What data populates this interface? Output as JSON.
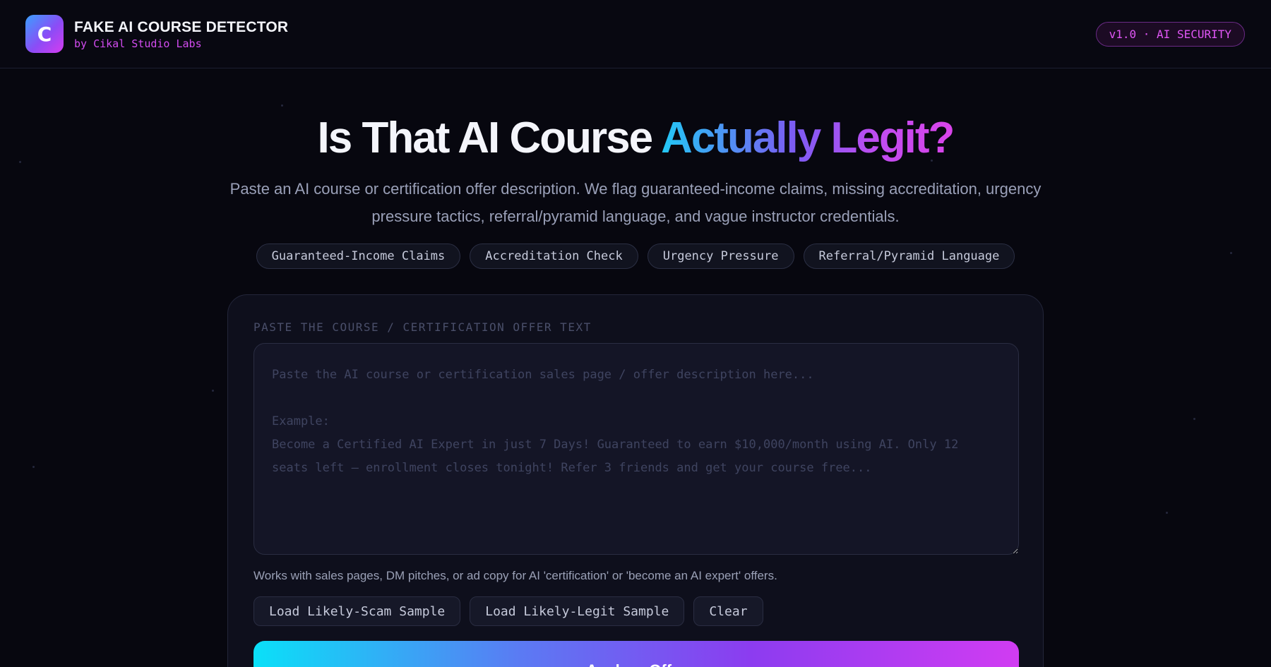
{
  "header": {
    "logo_letter": "C",
    "title": "FAKE AI COURSE DETECTOR",
    "subtitle": "by Cikal Studio Labs",
    "version_badge": "v1.0 · AI SECURITY"
  },
  "hero": {
    "title_main": "Is That AI Course ",
    "title_accent": "Actually Legit?",
    "description": "Paste an AI course or certification offer description. We flag guaranteed-income claims, missing accreditation, urgency pressure tactics, referral/pyramid language, and vague instructor credentials.",
    "features": [
      "Guaranteed-Income Claims",
      "Accreditation Check",
      "Urgency Pressure",
      "Referral/Pyramid Language"
    ]
  },
  "form": {
    "label": "PASTE THE COURSE / CERTIFICATION OFFER TEXT",
    "value": "",
    "placeholder": "Paste the AI course or certification sales page / offer description here...\n\nExample:\nBecome a Certified AI Expert in just 7 Days! Guaranteed to earn $10,000/month using AI. Only 12 seats left — enrollment closes tonight! Refer 3 friends and get your course free...",
    "hint": "Works with sales pages, DM pitches, or ad copy for AI 'certification' or 'become an AI expert' offers.",
    "buttons": {
      "scam_sample": "Load Likely-Scam Sample",
      "legit_sample": "Load Likely-Legit Sample",
      "clear": "Clear"
    },
    "analyze": "Analyze Offer"
  },
  "colors": {
    "background": "#07070f",
    "accent_pink": "#d24cf0",
    "accent_cyan": "#22c8f5",
    "accent_purple": "#8b4cf6"
  }
}
